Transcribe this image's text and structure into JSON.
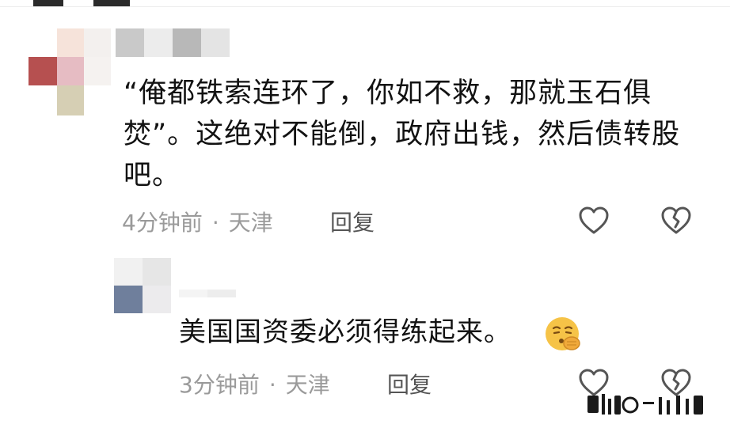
{
  "comment": {
    "text": "“俺都铁索连环了，你如不救，那就玉石俱焚”。这绝对不能倒，政府出钱，然后债转股吧。",
    "time": "4分钟前",
    "separator": "·",
    "location": "天津",
    "reply_label": "回复"
  },
  "reply": {
    "text": "美国国资委必须得练起来。",
    "time": "3分钟前",
    "separator": "·",
    "location": "天津",
    "reply_label": "回复"
  },
  "icons": {
    "like": "heart-outline-icon",
    "dislike": "broken-heart-icon",
    "emoji": "smirking-face-emoji-icon"
  },
  "colors": {
    "meta_text": "#9a9a9a",
    "reply_button": "#555555",
    "body_text": "#121212"
  }
}
